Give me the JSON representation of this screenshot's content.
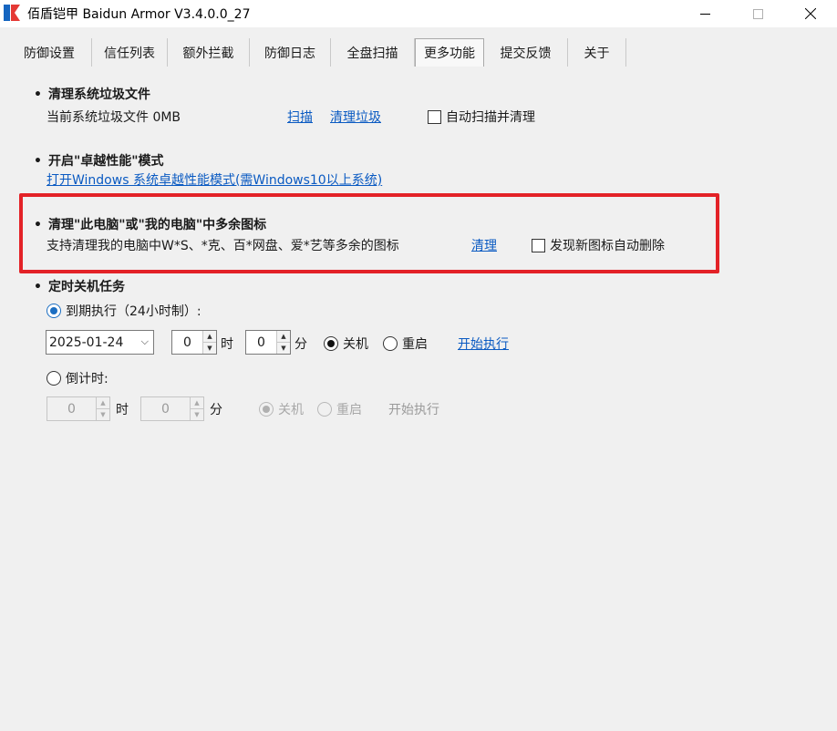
{
  "window": {
    "title": "佰盾铠甲 Baidun Armor  V3.4.0.0_27"
  },
  "colors": {
    "accent": "#0a5ac2",
    "highlight": "#e32227",
    "logo_blue": "#1565c0",
    "logo_red": "#e53935"
  },
  "tabs": [
    {
      "label": "防御设置"
    },
    {
      "label": "信任列表"
    },
    {
      "label": "额外拦截"
    },
    {
      "label": "防御日志"
    },
    {
      "label": "全盘扫描"
    },
    {
      "label": "更多功能",
      "active": true
    },
    {
      "label": "提交反馈"
    },
    {
      "label": "关于"
    }
  ],
  "junk": {
    "heading": "清理系统垃圾文件",
    "status": "当前系统垃圾文件  0MB",
    "scan_link": "扫描",
    "clean_link": "清理垃圾",
    "auto_checkbox": "自动扫描并清理"
  },
  "performance": {
    "heading": "开启\"卓越性能\"模式",
    "link": "打开Windows 系统卓越性能模式(需Windows10以上系统)"
  },
  "icons": {
    "heading": "清理\"此电脑\"或\"我的电脑\"中多余图标",
    "description": "支持清理我的电脑中W*S、*克、百*网盘、爱*艺等多余的图标",
    "clean_link": "清理",
    "auto_checkbox": "发现新图标自动删除"
  },
  "shutdown": {
    "heading": "定时关机任务",
    "scheduled_radio": "到期执行（24小时制）:",
    "date": "2025-01-24",
    "hour": "0",
    "hour_unit": "时",
    "minute": "0",
    "minute_unit": "分",
    "shutdown_radio": "关机",
    "restart_radio": "重启",
    "start_link": "开始执行",
    "countdown_radio": "倒计时:",
    "cd_hour": "0",
    "cd_hour_unit": "时",
    "cd_minute": "0",
    "cd_minute_unit": "分",
    "cd_shutdown_radio": "关机",
    "cd_restart_radio": "重启",
    "cd_start_label": "开始执行"
  }
}
